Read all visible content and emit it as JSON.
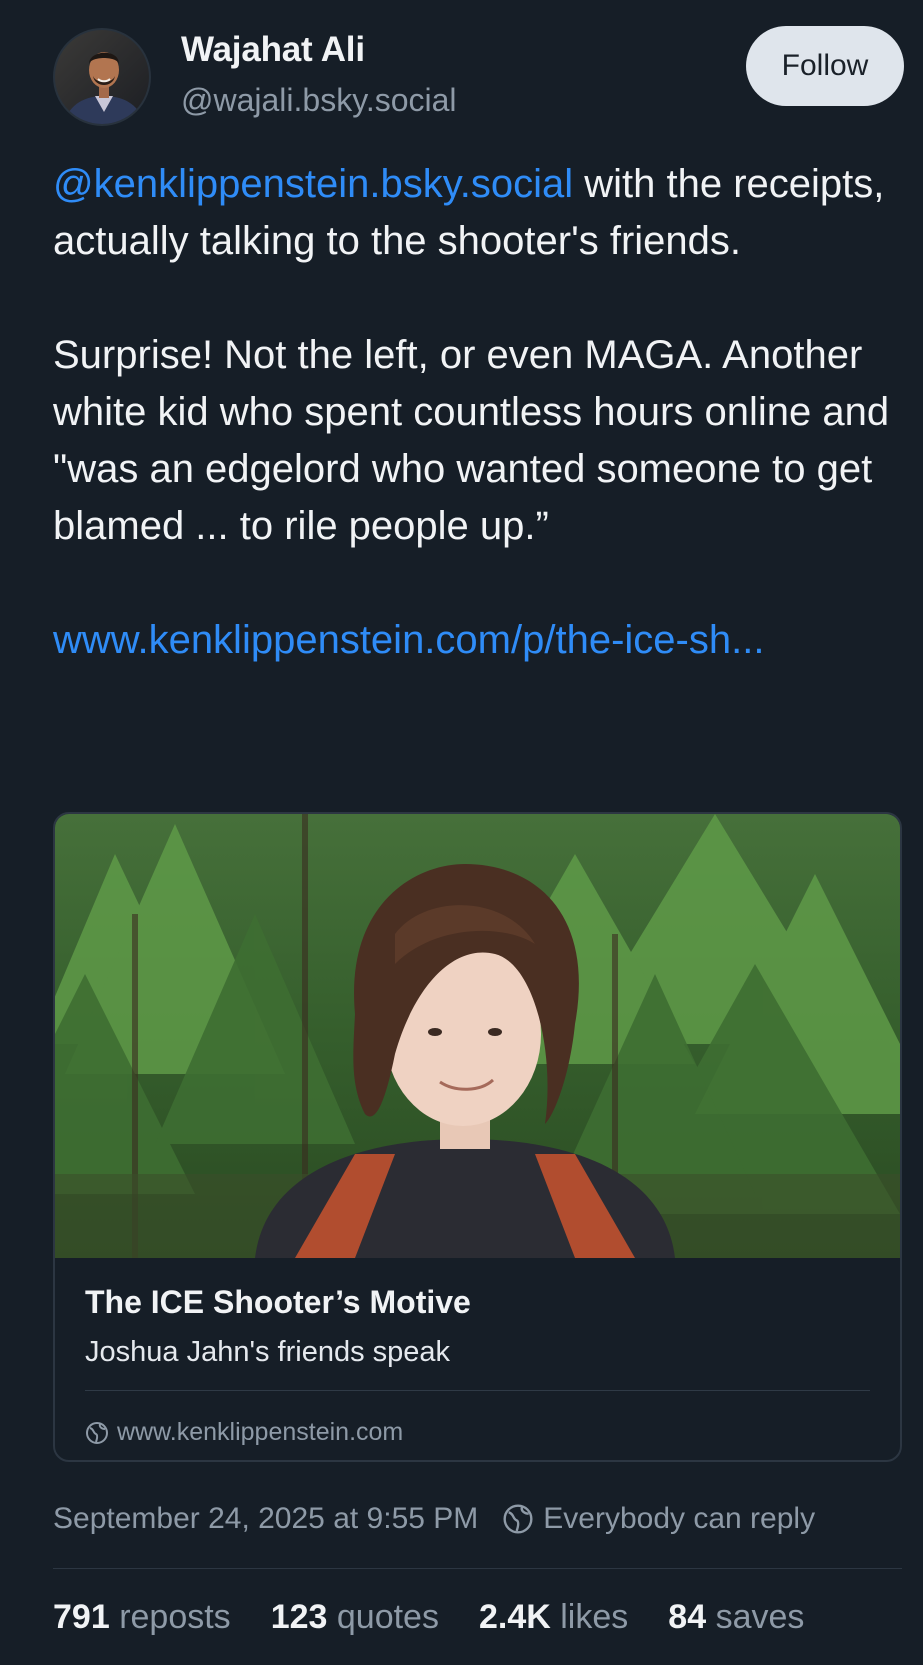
{
  "author": {
    "name": "Wajahat Ali",
    "handle": "@wajali.bsky.social"
  },
  "follow_label": "Follow",
  "post": {
    "mention": "@kenklippenstein.bsky.social",
    "line1_rest": " with the receipts, actually talking to the shooter's friends.",
    "paragraph2": "Surprise! Not the left, or even MAGA. Another white kid who spent countless hours online and \"was an edgelord who wanted someone to get blamed ... to rile people up.”",
    "link_text": "www.kenklippenstein.com/p/the-ice-sh..."
  },
  "card": {
    "title": "The ICE Shooter’s Motive",
    "description": "Joshua Jahn's friends speak",
    "domain": "www.kenklippenstein.com"
  },
  "meta": {
    "timestamp": "September 24, 2025 at 9:55 PM",
    "reply_setting": "Everybody can reply"
  },
  "stats": {
    "reposts_count": "791",
    "reposts_label": "reposts",
    "quotes_count": "123",
    "quotes_label": "quotes",
    "likes_count": "2.4K",
    "likes_label": "likes",
    "saves_count": "84",
    "saves_label": "saves"
  },
  "colors": {
    "background": "#161e27",
    "link": "#2f8cf7",
    "muted": "#8e9aa7",
    "follow_bg": "#dfe5ec"
  }
}
